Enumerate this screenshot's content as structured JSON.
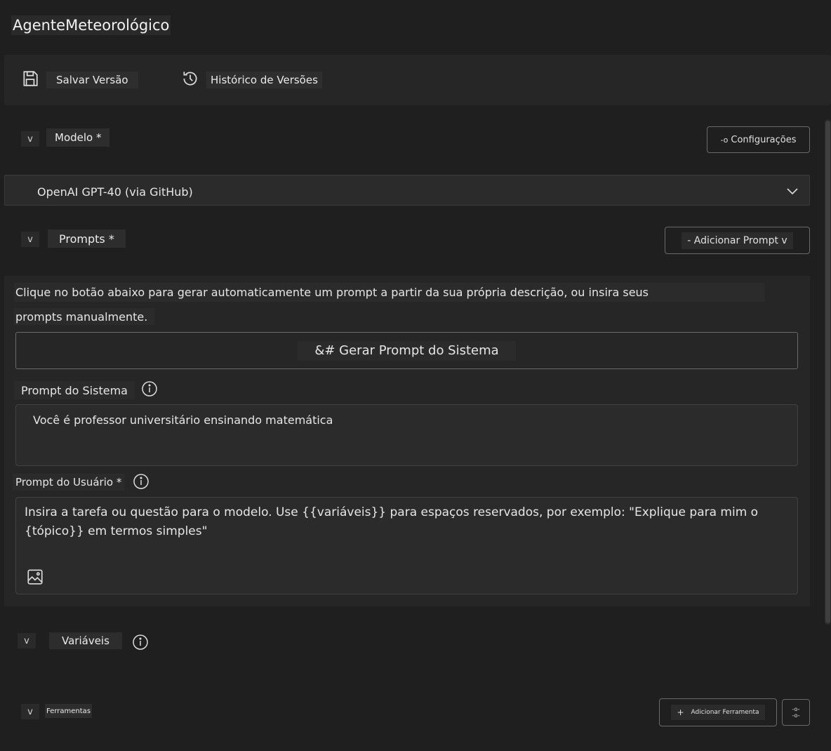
{
  "app": {
    "title": "AgenteMeteorológico"
  },
  "toolbar": {
    "save_label": "Salvar Versão",
    "history_label": "Histórico de Versões"
  },
  "model_section": {
    "toggle": "v",
    "label": "Modelo *",
    "settings_label": "Configurações",
    "settings_icon_text": "-o",
    "selected_model": "OpenAI GPT-40 (via GitHub)"
  },
  "prompts_section": {
    "toggle": "v",
    "label": "Prompts *",
    "add_prompt_label": "- Adicionar Prompt v",
    "description_line1": "Clique no botão abaixo para gerar automaticamente um prompt a partir da sua própria descrição, ou insira seus",
    "description_line2": "prompts manualmente.",
    "generate_button": "&# Gerar Prompt do Sistema",
    "system_prompt_label": "Prompt do Sistema",
    "system_prompt_value": "Você é professor universitário ensinando matemática",
    "user_prompt_label": "Prompt do Usuário *",
    "user_prompt_line1": "Insira a tarefa ou questão para o modelo. Use {{variáveis}} para espaços reservados, por exemplo: \"Explique para mim o",
    "user_prompt_line2": "{tópico}} em termos simples\""
  },
  "variables_section": {
    "toggle": "v",
    "label": "Variáveis"
  },
  "tools_section": {
    "toggle": "v",
    "label": "Ferramentas",
    "add_tool_plus": "+",
    "add_tool_label": "Adicionar Ferramenta",
    "more_icon_text_1": "-o-",
    "more_icon_text_2": "-o-"
  },
  "icons": {
    "save": "save-icon",
    "history": "history-icon",
    "info": "info-icon",
    "image": "image-icon",
    "chevron": "chevron-down-icon"
  }
}
